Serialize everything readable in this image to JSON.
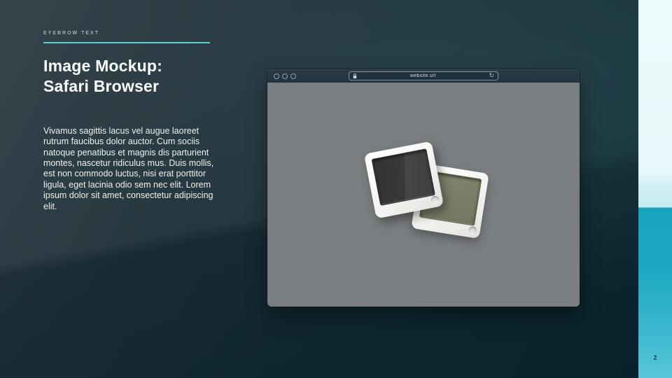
{
  "slide": {
    "eyebrow": "EYEBROW TEXT",
    "title_line1": "Image Mockup:",
    "title_line2": "Safari Browser",
    "body": "Vivamus sagittis lacus vel augue laoreet rutrum faucibus dolor auctor. Cum sociis natoque penatibus et magnis dis parturient montes, nascetur ridiculus mus. Duis mollis, est non commodo luctus, nisi erat porttitor ligula, eget lacinia odio sem nec elit. Lorem ipsum dolor sit amet, consectetur adipiscing elit.",
    "page_number": "2",
    "colors": {
      "accent_teal": "#5ecfd5",
      "background_top": "#37444c",
      "background_bottom": "#0e2c35",
      "strip_light": "#e9fafc",
      "strip_turquoise": "#1ba7c1",
      "title_text": "#fdfefe",
      "body_text": "#eef1f2"
    }
  },
  "browser": {
    "url": "website.url",
    "window_controls": [
      "close",
      "minimize",
      "zoom"
    ],
    "icons": {
      "lock": "lock-icon",
      "reload_glyph": "↻"
    },
    "chrome_color": "#24333d",
    "content_background": "#7a7e81"
  }
}
